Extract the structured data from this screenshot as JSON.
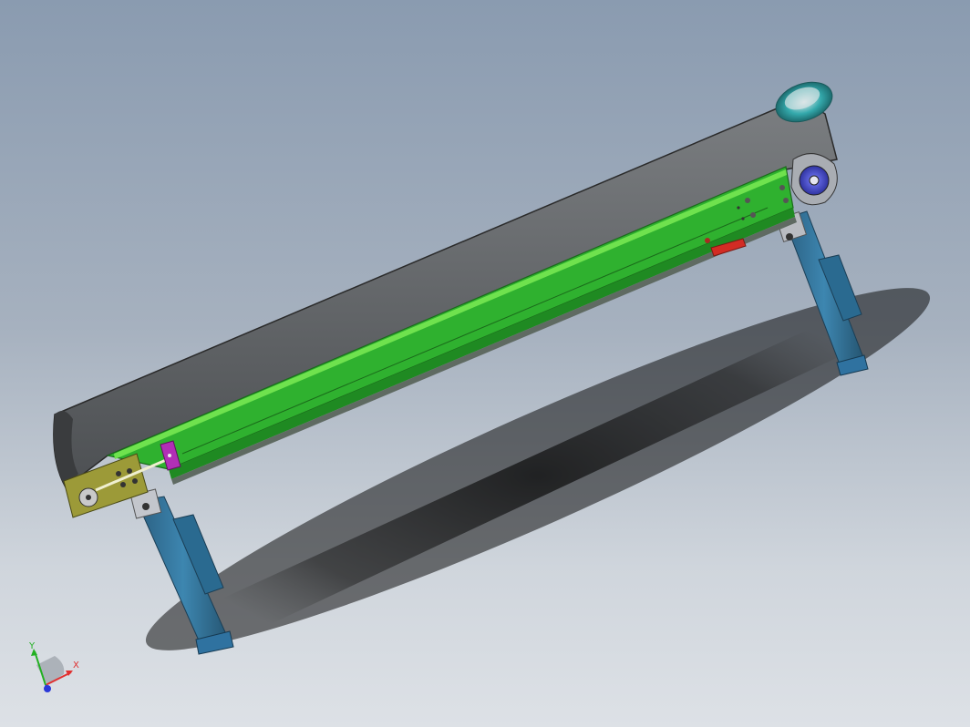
{
  "viewport": {
    "background_top": "#8a9bb0",
    "background_bottom": "#dde1e6"
  },
  "model": {
    "belt_color": "#5a5d5f",
    "frame_color": "#2fb12f",
    "frame_stripe_color": "#66e24a",
    "leg_color": "#2f6f95",
    "tensioner_color": "#9c9a38",
    "clamp_color": "#b12fb5",
    "stop_color": "#d22c24",
    "drive_hub_color": "#4a4fc8",
    "drive_motor_color": "#2ea0a0"
  },
  "triad": {
    "x_label": "X",
    "y_label": "Y",
    "x_color": "#e03030",
    "y_color": "#22b022",
    "z_color": "#2a38d8"
  }
}
